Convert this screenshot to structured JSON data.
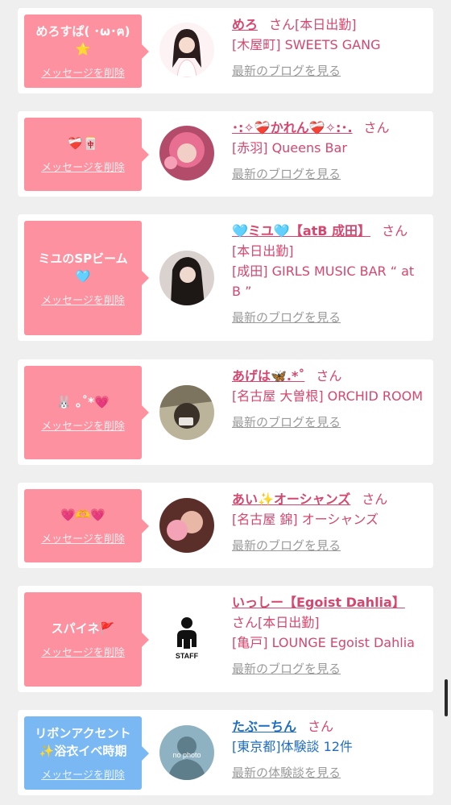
{
  "entries": [
    {
      "message": "めろすぱ( ･ω･ฅ)⭐",
      "delete": "メッセージを削除",
      "name": "めろ",
      "san": "さん",
      "inline": "[本日出勤]",
      "lines": [
        "[木屋町] SWEETS GANG"
      ],
      "blog": "最新のブログを見る"
    },
    {
      "message": "❤️‍🩹🀄",
      "delete": "メッセージを削除",
      "name": "･:✧❤️‍🩹かれん❤️‍🩹✧:･.",
      "san": "さん",
      "lines": [
        "[赤羽] Queens Bar"
      ],
      "blog": "最新のブログを見る"
    },
    {
      "message": "ミユのSPビーム 🩵",
      "delete": "メッセージを削除",
      "name": "🩵ミユ🩵【atB 成田】",
      "san": "さん",
      "lines": [
        "[本日出勤]",
        "[成田] GIRLS MUSIC BAR “ at B ”"
      ],
      "blog": "最新のブログを見る"
    },
    {
      "message": "🐰 ｡˚*💗",
      "delete": "メッセージを削除",
      "name": "あげは🦋.*˚",
      "san": "さん",
      "lines": [
        "[名古屋 大曽根] ORCHID ROOM"
      ],
      "blog": "最新のブログを見る"
    },
    {
      "message": "💗🫶💗",
      "delete": "メッセージを削除",
      "name": "あい✨オーシャンズ",
      "san": "さん",
      "lines": [
        "[名古屋 錦] オーシャンズ"
      ],
      "blog": "最新のブログを見る"
    },
    {
      "message": "スパイネ🚩",
      "delete": "メッセージを削除",
      "name": "いっしー【Egoist Dahlia】",
      "san": "さん",
      "inline": "[本日出勤]",
      "lines": [
        "[亀戸] LOUNGE Egoist Dahlia"
      ],
      "blog": "最新のブログを見る",
      "avatar_label": "STAFF"
    },
    {
      "message": "リボンアクセント ✨浴衣イベ時期",
      "delete": "メッセージを削除",
      "name": "たぶーちん",
      "san": "さん",
      "lines": [
        "[東京都]体験談 12件"
      ],
      "blog": "最新の体験談を見る",
      "avatar_label": "no photo"
    }
  ],
  "colors": {
    "pink": "#fd919f",
    "blue": "#79b8f3",
    "name_pink": "#d5476e",
    "name_blue": "#1f6ec2",
    "link_gray": "#9a9a9a"
  }
}
